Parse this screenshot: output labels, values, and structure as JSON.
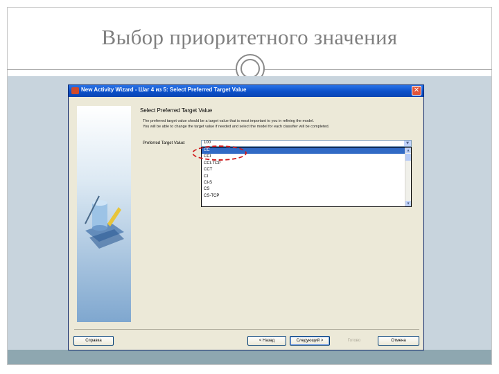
{
  "slide": {
    "title": "Выбор приоритетного значения"
  },
  "window": {
    "title": "New Activity Wizard - Шаг 4 из 5: Select Preferred Target Value",
    "close_label": "✕",
    "section_header": "Select Preferred Target Value",
    "description_lines": [
      "The preferred target value should be a target value that is most important to you in refining the model.",
      "You will be able to change the target value if needed and select the model for each classifier will be completed."
    ],
    "field_label": "Preferred Target Value:",
    "combo_value": "100",
    "list_items": [
      "CC",
      "CCI",
      "CCI-TCP",
      "CCT",
      "CI",
      "CI-S",
      "CS",
      "CS-TCP"
    ],
    "selected_index": 0,
    "buttons": {
      "help": "Справка",
      "back": "< Назад",
      "next": "Следующий >",
      "finish": "Готово",
      "cancel": "Отмена"
    }
  },
  "colors": {
    "selection": "#316ac5",
    "highlight_circle": "#d0191b",
    "titlebar": "#0b4fc8"
  }
}
